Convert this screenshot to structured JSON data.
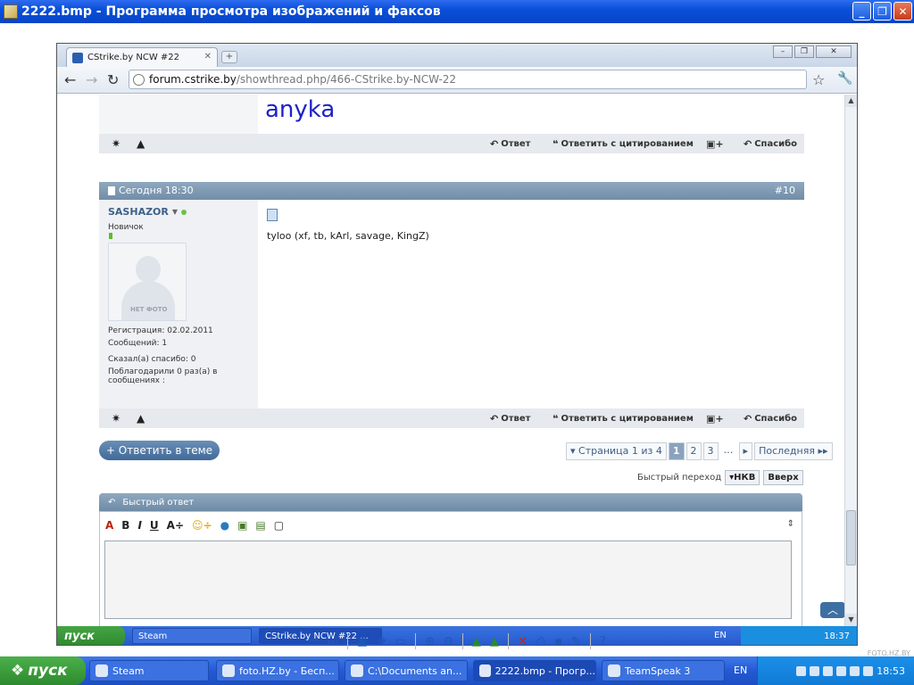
{
  "viewer": {
    "title": "2222.bmp - Программа просмотра изображений и факсов",
    "watermark": "FOTO.HZ.BY"
  },
  "browser": {
    "tab_title": "CStrike.by NCW #22",
    "url_host": "forum.cstrike.by",
    "url_path": "/showthread.php/466-CStrike.by-NCW-22"
  },
  "forum": {
    "prev_post_sig": "anyka",
    "actions": {
      "reply": "Ответ",
      "quote": "Ответить с цитированием",
      "thanks": "Спасибо"
    },
    "post": {
      "date": "Сегодня 18:30",
      "number": "#10",
      "username": "SASHAZOR",
      "rank": "Новичок",
      "no_photo": "НЕТ ФОТО",
      "registration": "Регистрация:   02.02.2011",
      "messages": "Сообщений:   1",
      "said_thanks": "Сказал(а) спасибо:   0",
      "thanked_line1": "Поблагодарили 0 раз(а) в",
      "thanked_line2": "сообщениях :",
      "text": "tyloo (xf, tb, kArl, savage, KingZ)"
    },
    "reply_in_thread": "+ Ответить в теме",
    "pager": {
      "label": "▾ Страница 1 из 4",
      "pages": [
        "1",
        "2",
        "3"
      ],
      "ellipsis": "…",
      "next": "▸",
      "last": "Последняя ▸▸"
    },
    "quick_jump": {
      "label": "Быстрый переход",
      "nkv": "▾НКВ",
      "top": "Вверх"
    },
    "quick_reply": "Быстрый ответ"
  },
  "inner_taskbar": {
    "start": "пуск",
    "tasks": [
      "Steam",
      "CStrike.by NCW #22 ..."
    ],
    "lang": "EN",
    "clock": "18:37"
  },
  "taskbar": {
    "start": "пуск",
    "tasks": [
      "Steam",
      "foto.HZ.by - Бесп...",
      "C:\\Documents an...",
      "2222.bmp - Прогр...",
      "TeamSpeak 3"
    ],
    "lang": "EN",
    "clock": "18:53"
  }
}
